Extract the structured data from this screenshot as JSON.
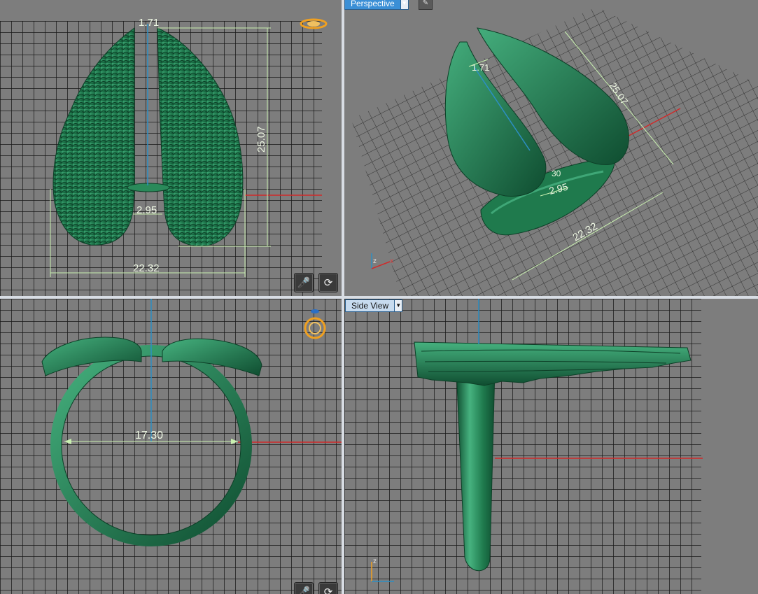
{
  "viewports": {
    "top_left": {
      "dims": {
        "top_width": "1.71",
        "height": "25.07",
        "gap": "2.95",
        "width": "22.32"
      }
    },
    "top_right": {
      "view_label": "Perspective",
      "dims": {
        "top_width": "1.71",
        "height": "25.07",
        "gap1": "2.95",
        "gap2": "30",
        "width": "22.32"
      },
      "axis": {
        "z": "z",
        "x": "x"
      }
    },
    "bottom_left": {
      "dims": {
        "inner_diameter": "17.30"
      }
    },
    "bottom_right": {
      "view_label": "Side View",
      "axis": {
        "z": "z"
      }
    }
  },
  "icons": {
    "dropdown": "triangle-down",
    "microphone": "microphone-icon",
    "rotate": "rotate-icon",
    "orbit": "orbit-gizmo-icon",
    "ring_gizmo": "ring-gizmo-icon"
  },
  "colors": {
    "viewport_bg": "#7d7d7d",
    "model_green": "#1f7a4d",
    "dimension_line": "#c9f0b0",
    "axis_red": "#d12a2a",
    "axis_blue": "#2c8fc4",
    "view_label_active": "#3b8fd6",
    "view_label_inactive": "#c7dbef"
  }
}
